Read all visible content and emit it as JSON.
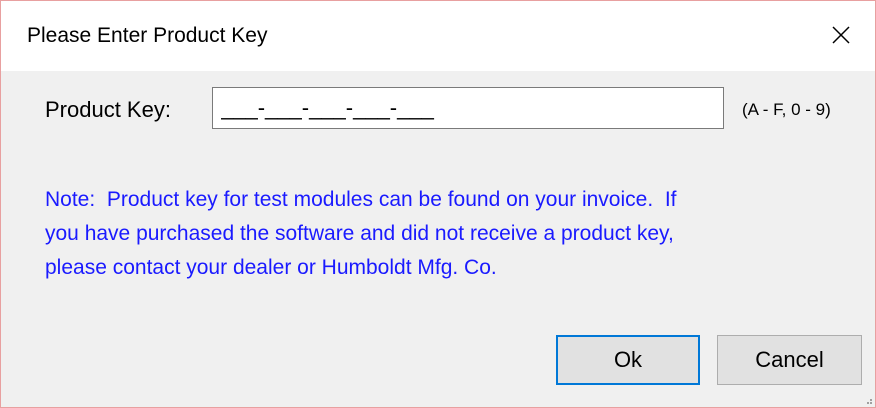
{
  "window": {
    "title": "Please Enter Product Key",
    "close_icon": "close-icon"
  },
  "product_key": {
    "label": "Product Key:",
    "value": "___-___-___-___-___",
    "hint": "(A - F, 0 - 9)"
  },
  "note": {
    "lines": [
      "Note:  Product key for test modules can be found on your invoice.  If",
      "you have purchased the software and did not receive a product key,",
      "please contact your dealer or Humboldt Mfg. Co."
    ]
  },
  "buttons": {
    "ok_label": "Ok",
    "cancel_label": "Cancel"
  },
  "colors": {
    "note_text": "#1a1aff",
    "default_button_border": "#0078d7",
    "window_border": "#e8a0a0"
  }
}
